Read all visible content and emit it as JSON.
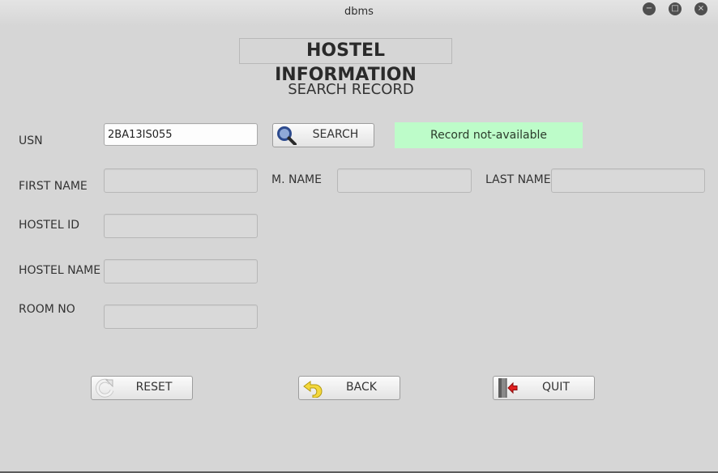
{
  "window": {
    "title": "dbms",
    "controls": {
      "minimize": "−",
      "maximize": "□",
      "close": "×"
    }
  },
  "header": {
    "title": "HOSTEL INFORMATION",
    "subtitle": "SEARCH RECORD"
  },
  "form": {
    "usn": {
      "label": "USN",
      "value": "2BA13IS055"
    },
    "first_name": {
      "label": "FIRST NAME",
      "value": ""
    },
    "middle_name": {
      "label": "M. NAME",
      "value": ""
    },
    "last_name": {
      "label": "LAST NAME",
      "value": ""
    },
    "hostel_id": {
      "label": "HOSTEL ID",
      "value": ""
    },
    "hostel_name": {
      "label": "HOSTEL NAME",
      "value": ""
    },
    "room_no": {
      "label": "ROOM NO",
      "value": ""
    }
  },
  "search_button": {
    "label": "SEARCH",
    "icon": "magnifier-icon"
  },
  "status": {
    "text": "Record not-available",
    "color": "#bdfcc9"
  },
  "actions": {
    "reset": {
      "label": "RESET",
      "icon": "refresh-icon"
    },
    "back": {
      "label": "BACK",
      "icon": "back-arrow-icon"
    },
    "quit": {
      "label": "QUIT",
      "icon": "exit-door-icon"
    }
  }
}
